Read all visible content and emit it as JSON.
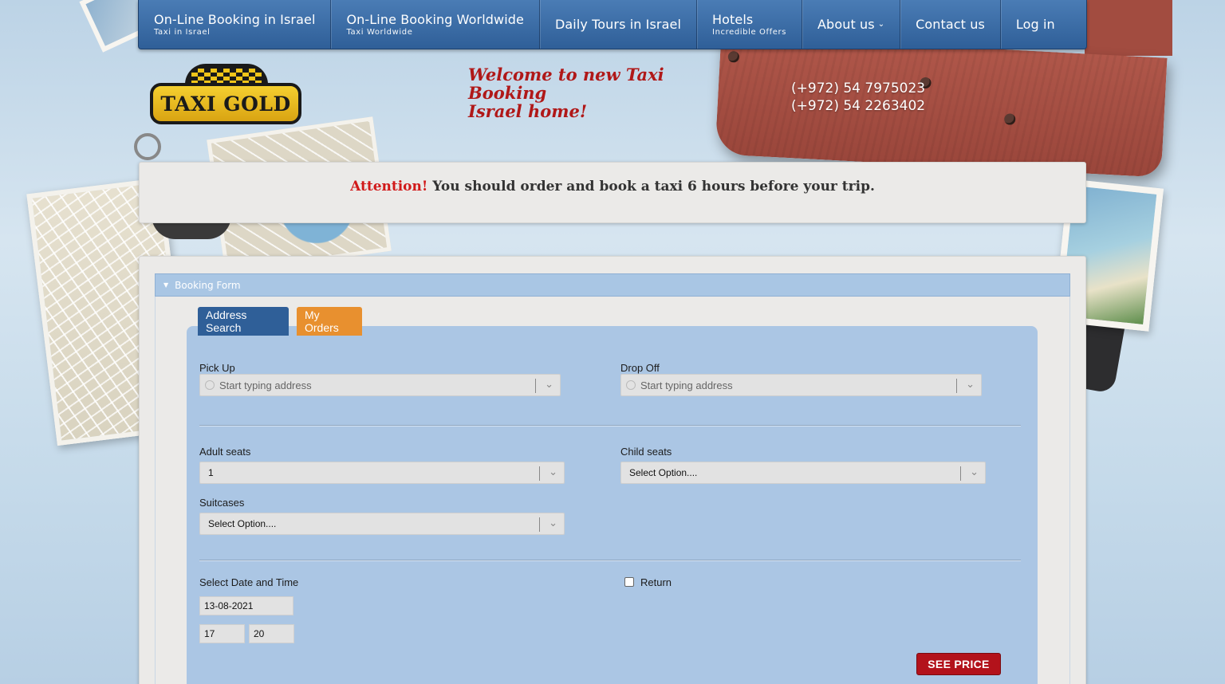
{
  "nav": {
    "items": [
      {
        "label": "On-Line Booking in Israel",
        "sub": "Taxi in Israel"
      },
      {
        "label": "On-Line Booking Worldwide",
        "sub": "Taxi Worldwide"
      },
      {
        "label": "Daily Tours in Israel",
        "sub": ""
      },
      {
        "label": "Hotels",
        "sub": "Incredible Offers"
      },
      {
        "label": "About us",
        "sub": ""
      },
      {
        "label": "Contact us",
        "sub": ""
      },
      {
        "label": "Log in",
        "sub": ""
      }
    ]
  },
  "header": {
    "logo_text": "TAXI GOLD",
    "welcome_line1": "Welcome to new Taxi Booking",
    "welcome_line2": "Israel home!",
    "phone1": "(+972) 54 7975023",
    "phone2": "(+972) 54 2263402"
  },
  "notice": {
    "highlight": "Attention!",
    "text": "You should order and book a taxi 6 hours before your trip."
  },
  "booking": {
    "section_title": "Booking Form",
    "tabs": [
      {
        "label": "Address Search"
      },
      {
        "label": "My Orders"
      }
    ],
    "pickup": {
      "label": "Pick Up",
      "placeholder": "Start typing address"
    },
    "dropoff": {
      "label": "Drop Off",
      "placeholder": "Start typing address"
    },
    "adult_seats": {
      "label": "Adult seats",
      "value": "1"
    },
    "child_seats": {
      "label": "Child seats",
      "value": "Select Option...."
    },
    "suitcases": {
      "label": "Suitcases",
      "value": "Select Option...."
    },
    "datetime": {
      "label": "Select Date and Time",
      "date": "13-08-2021",
      "hour": "17",
      "minute": "20"
    },
    "return_label": "Return",
    "see_price": "SEE PRICE"
  },
  "colors": {
    "nav_bg": "#2f5f98",
    "brand_gold": "#f0c419",
    "attention_red": "#d11a1a",
    "welcome_red": "#b01818",
    "tab_orange": "#e8902f",
    "button_red": "#b3121b",
    "form_bg": "#abc6e4"
  }
}
